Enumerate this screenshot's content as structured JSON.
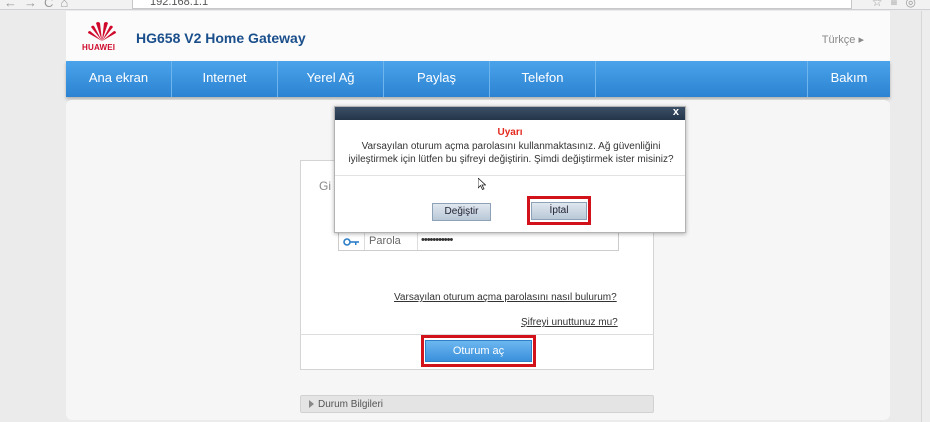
{
  "browser": {
    "url": "192.168.1.1"
  },
  "header": {
    "brand": "HUAWEI",
    "title": "HG658 V2 Home Gateway",
    "language": "Türkçe ▸"
  },
  "nav": {
    "items": [
      {
        "label": "Ana ekran"
      },
      {
        "label": "Internet"
      },
      {
        "label": "Yerel Ağ"
      },
      {
        "label": "Paylaş"
      },
      {
        "label": "Telefon"
      },
      {
        "label": ""
      },
      {
        "label": "Bakım"
      }
    ]
  },
  "login": {
    "heading_partial": "Gi",
    "password_label": "Parola",
    "password_value": "•••••••••••",
    "how_to_find_link": "Varsayılan oturum açma parolasını nasıl bulurum?",
    "forgot_link": "Şifreyi unuttunuz mu?",
    "login_button": "Oturum aç"
  },
  "status": {
    "label": "Durum Bilgileri"
  },
  "modal": {
    "close": "x",
    "title": "Uyarı",
    "message": "Varsayılan oturum açma parolasını kullanmaktasınız. Ağ güvenliğini iyileştirmek için lütfen bu şifreyi değiştirin. Şimdi değiştirmek ister misiniz?",
    "change_button": "Değiştir",
    "cancel_button": "İptal"
  },
  "colors": {
    "nav_blue": "#2c83d2",
    "title_blue": "#1a4f8b",
    "warning_red": "#e4291f",
    "highlight_red": "#d2121b",
    "huawei_red": "#cf0a2c"
  }
}
